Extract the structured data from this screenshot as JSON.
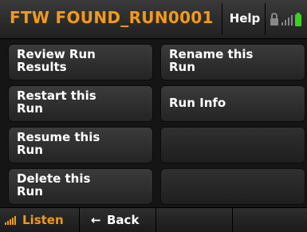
{
  "header": {
    "title": "FTW FOUND_RUN0001",
    "help_label": "Help"
  },
  "menu": {
    "left": [
      {
        "line1": "Review Run",
        "line2": "Results"
      },
      {
        "line1": "Restart this",
        "line2": "Run"
      },
      {
        "line1": "Resume this",
        "line2": "Run"
      },
      {
        "line1": "Delete this",
        "line2": "Run"
      }
    ],
    "right": [
      {
        "line1": "Rename this",
        "line2": "Run"
      },
      {
        "line1": "Run Info",
        "line2": ""
      },
      {
        "line1": "",
        "line2": ""
      },
      {
        "line1": "",
        "line2": ""
      }
    ]
  },
  "footer": {
    "listen_label": "Listen",
    "back_label": "Back",
    "back_arrow": "←"
  },
  "colors": {
    "accent": "#f29a1a",
    "battery": "#3ad11f"
  }
}
